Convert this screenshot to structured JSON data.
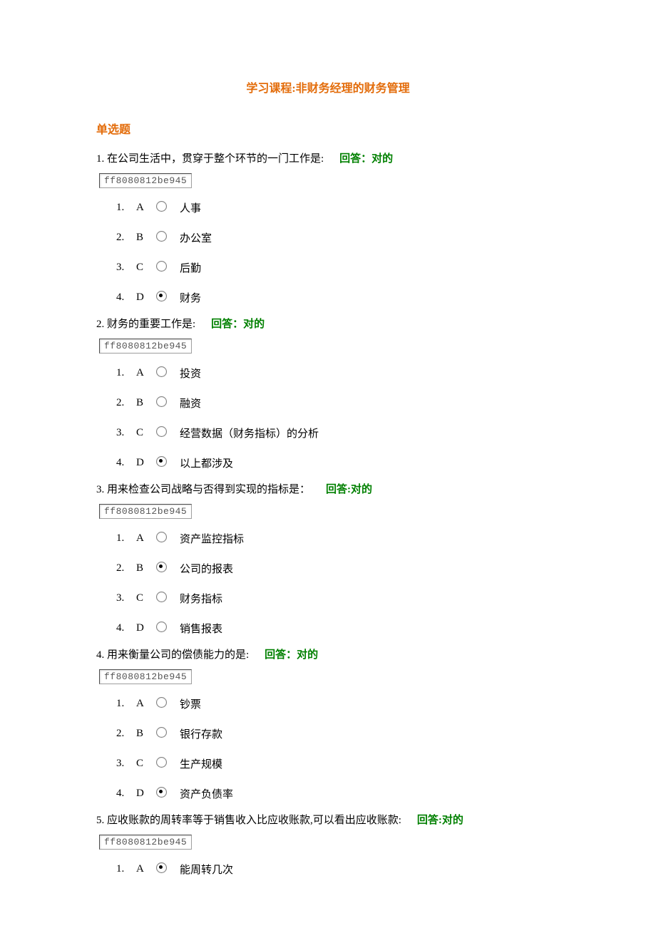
{
  "course_title": "学习课程:非财务经理的财务管理",
  "section_title": "单选题",
  "answer_prefix": "回答：",
  "answer_value": "对的",
  "answer_prefix_colon2": "回答:",
  "questions": [
    {
      "num": "1.",
      "text": "在公司生活中，贯穿于整个环节的一门工作是:",
      "id_box": "ff8080812be945",
      "answer_label": "回答：对的",
      "options": [
        {
          "n": "1.",
          "letter": "A",
          "label": "人事",
          "selected": false
        },
        {
          "n": "2.",
          "letter": "B",
          "label": "办公室",
          "selected": false
        },
        {
          "n": "3.",
          "letter": "C",
          "label": "后勤",
          "selected": false
        },
        {
          "n": "4.",
          "letter": "D",
          "label": "财务",
          "selected": true
        }
      ]
    },
    {
      "num": "2.",
      "text": "财务的重要工作是:",
      "id_box": "ff8080812be945",
      "answer_label": "回答：对的",
      "options": [
        {
          "n": "1.",
          "letter": "A",
          "label": "投资",
          "selected": false
        },
        {
          "n": "2.",
          "letter": "B",
          "label": "融资",
          "selected": false
        },
        {
          "n": "3.",
          "letter": "C",
          "label": "经营数据（财务指标）的分析",
          "selected": false
        },
        {
          "n": "4.",
          "letter": "D",
          "label": "以上都涉及",
          "selected": true
        }
      ]
    },
    {
      "num": "3.",
      "text": "用来检查公司战略与否得到实现的指标是：",
      "id_box": "ff8080812be945",
      "answer_label": "回答:对的",
      "options": [
        {
          "n": "1.",
          "letter": "A",
          "label": "资产监控指标",
          "selected": false
        },
        {
          "n": "2.",
          "letter": "B",
          "label": "公司的报表",
          "selected": true
        },
        {
          "n": "3.",
          "letter": "C",
          "label": "财务指标",
          "selected": false
        },
        {
          "n": "4.",
          "letter": "D",
          "label": "销售报表",
          "selected": false
        }
      ]
    },
    {
      "num": "4.",
      "text": "用来衡量公司的偿债能力的是:",
      "id_box": "ff8080812be945",
      "answer_label": "回答：对的",
      "options": [
        {
          "n": "1.",
          "letter": "A",
          "label": "钞票",
          "selected": false
        },
        {
          "n": "2.",
          "letter": "B",
          "label": "银行存款",
          "selected": false
        },
        {
          "n": "3.",
          "letter": "C",
          "label": "生产规模",
          "selected": false
        },
        {
          "n": "4.",
          "letter": "D",
          "label": "资产负债率",
          "selected": true
        }
      ]
    },
    {
      "num": "5.",
      "text": "应收账款的周转率等于销售收入比应收账款,可以看出应收账款:",
      "id_box": "ff8080812be945",
      "answer_label": "回答:对的",
      "options": [
        {
          "n": "1.",
          "letter": "A",
          "label": "能周转几次",
          "selected": true
        }
      ]
    }
  ]
}
